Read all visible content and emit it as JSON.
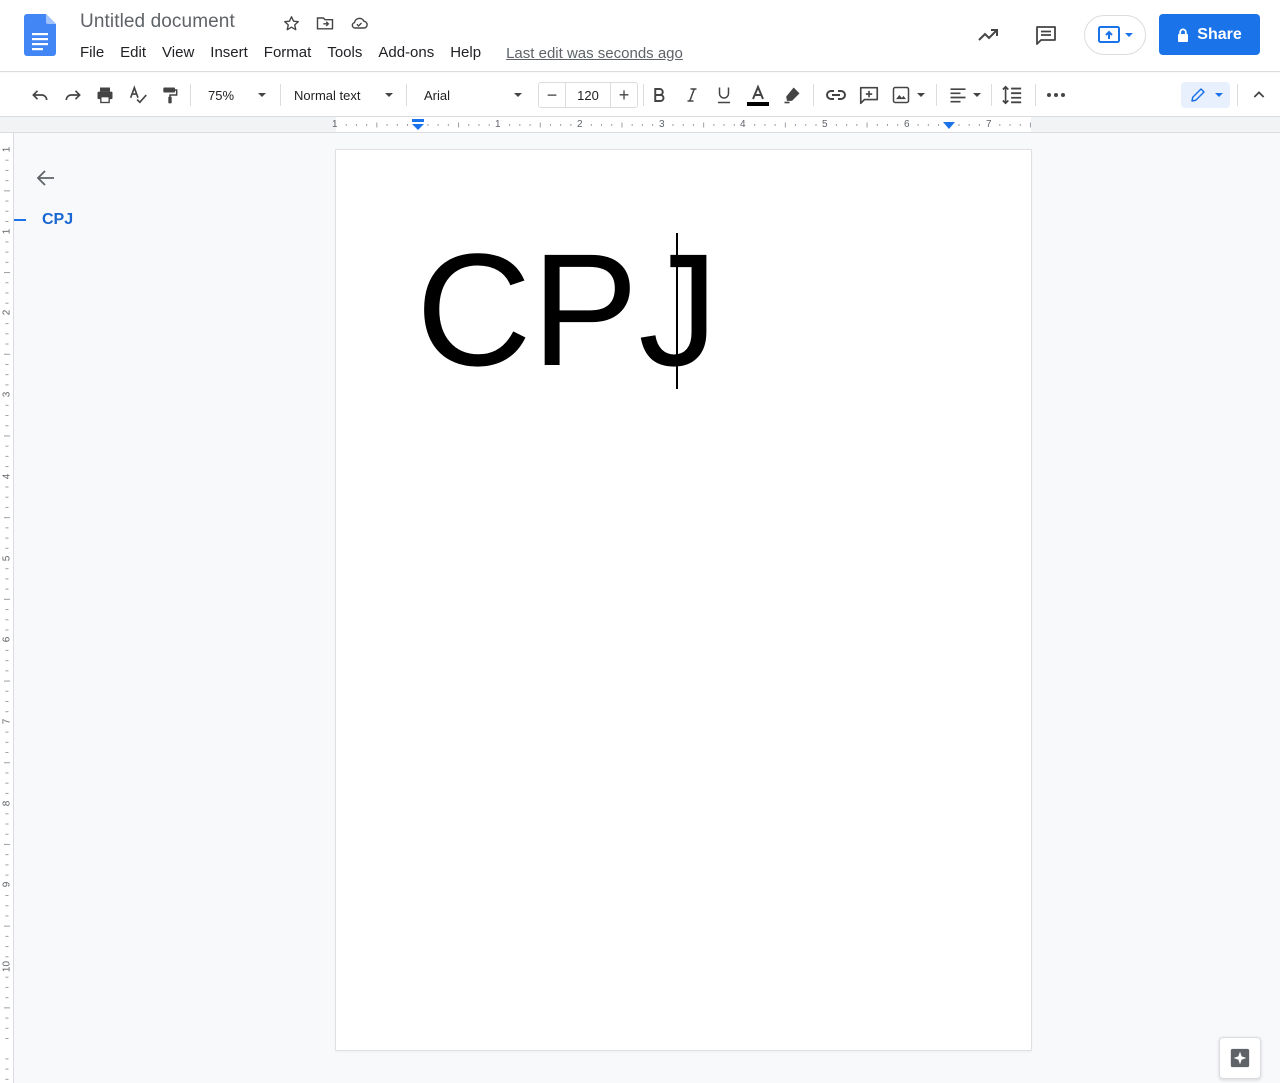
{
  "header": {
    "title": "Untitled document",
    "menu": [
      "File",
      "Edit",
      "View",
      "Insert",
      "Format",
      "Tools",
      "Add-ons",
      "Help"
    ],
    "last_edit": "Last edit was seconds ago",
    "share_label": "Share"
  },
  "toolbar": {
    "zoom": "75%",
    "style": "Normal text",
    "font": "Arial",
    "font_size": "120",
    "minus": "−",
    "plus": "+"
  },
  "ruler": {
    "numbers": [
      "1",
      "1",
      "2",
      "3",
      "4",
      "5",
      "6",
      "7"
    ]
  },
  "vruler": {
    "numbers": [
      "1",
      "1",
      "2",
      "3",
      "4",
      "5",
      "6",
      "7",
      "8",
      "9",
      "10"
    ]
  },
  "outline": {
    "items": [
      "CPJ"
    ]
  },
  "document": {
    "text": "CPJ"
  },
  "colors": {
    "accent": "#1a73e8",
    "doc_icon": "#4285f4"
  }
}
